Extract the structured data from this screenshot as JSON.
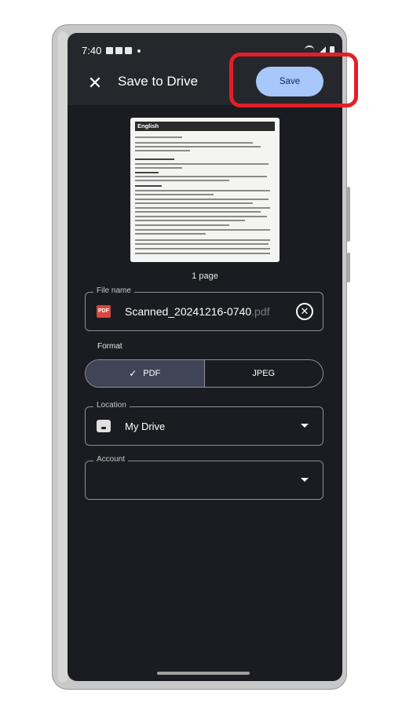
{
  "status_bar": {
    "time": "7:40"
  },
  "app_bar": {
    "close_icon": "close-icon",
    "title": "Save to Drive",
    "save_label": "Save"
  },
  "preview": {
    "doc_heading": "English",
    "page_count": "1 page"
  },
  "file_name": {
    "label": "File name",
    "icon_text": "PDF",
    "value": "Scanned_20241216-0740",
    "extension": ".pdf"
  },
  "format": {
    "label": "Format",
    "options": [
      "PDF",
      "JPEG"
    ],
    "selected": "PDF"
  },
  "location": {
    "label": "Location",
    "value": "My Drive"
  },
  "account": {
    "label": "Account",
    "value": ""
  },
  "colors": {
    "highlight": "#e21f26",
    "save_button": "#a8c7fa",
    "background": "#1b1c21"
  }
}
